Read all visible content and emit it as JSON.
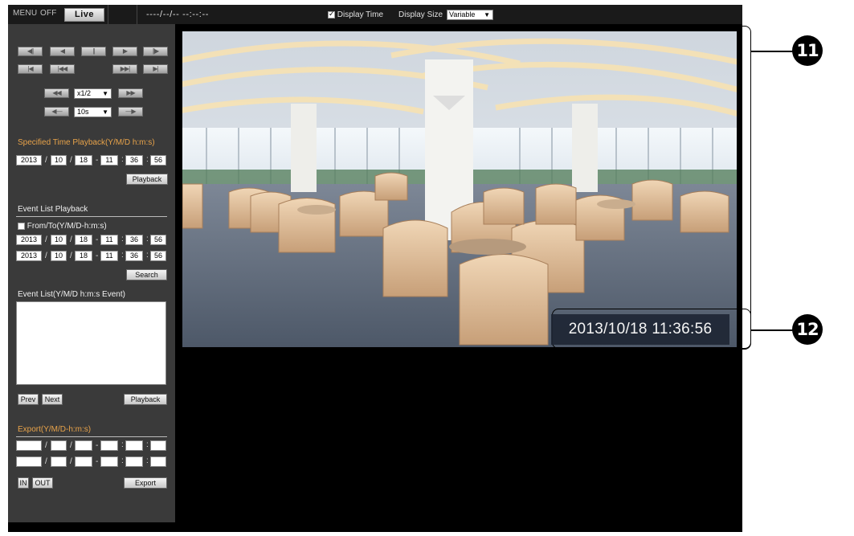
{
  "topbar": {
    "menu_label": "MENU",
    "off_label": "OFF",
    "live_label": "Live",
    "time_display": "----/--/-- --:--:--",
    "display_time_label": "Display Time",
    "display_time_checked": true,
    "display_size_label": "Display Size",
    "display_size_value": "Variable"
  },
  "playback": {
    "speed_value": "x1/2",
    "skip_value": "10s"
  },
  "specified": {
    "title": "Specified Time Playback(Y/M/D h:m:s)",
    "year": "2013",
    "month": "10",
    "day": "18",
    "hour": "11",
    "minute": "36",
    "second": "56",
    "playback_label": "Playback"
  },
  "event_list_playback": {
    "title": "Event List Playback",
    "fromto_label": "From/To(Y/M/D-h:m:s)",
    "from": {
      "year": "2013",
      "month": "10",
      "day": "18",
      "hour": "11",
      "minute": "36",
      "second": "56"
    },
    "to": {
      "year": "2013",
      "month": "10",
      "day": "18",
      "hour": "11",
      "minute": "36",
      "second": "56"
    },
    "search_label": "Search",
    "list_label": "Event List(Y/M/D h:m:s Event)",
    "prev_label": "Prev",
    "next_label": "Next",
    "playback_label": "Playback"
  },
  "export": {
    "title": "Export(Y/M/D-h:m:s)",
    "in_label": "IN",
    "out_label": "OUT",
    "export_label": "Export"
  },
  "video": {
    "timestamp": "2013/10/18 11:36:56"
  },
  "callouts": {
    "c11": "11",
    "c12": "12"
  }
}
